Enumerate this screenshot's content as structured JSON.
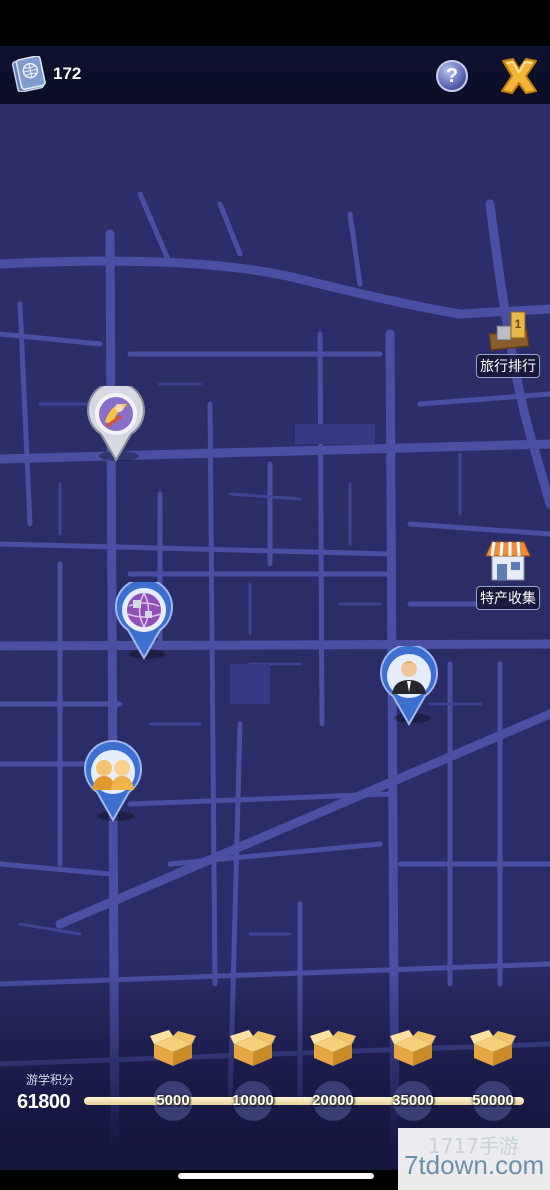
{
  "top_bar": {
    "passport_icon": "passport-icon",
    "passport_count": "172",
    "help_label": "?",
    "close_icon": "close-x-icon"
  },
  "side_buttons": {
    "ranking_label": "旅行排行",
    "specialty_label": "特产收集"
  },
  "map_pins": [
    {
      "name": "pin-opera",
      "icon": "opera-performer-icon",
      "theme": "silver"
    },
    {
      "name": "pin-globe",
      "icon": "globe-icon",
      "theme": "blue"
    },
    {
      "name": "pin-businessman",
      "icon": "businessman-icon",
      "theme": "blue"
    },
    {
      "name": "pin-family",
      "icon": "family-icon",
      "theme": "blue"
    }
  ],
  "score": {
    "label": "游学积分",
    "value": "61800"
  },
  "milestones": [
    {
      "label": "5000",
      "icon": "treasure-chest-icon"
    },
    {
      "label": "10000",
      "icon": "treasure-chest-icon"
    },
    {
      "label": "20000",
      "icon": "treasure-chest-icon"
    },
    {
      "label": "35000",
      "icon": "treasure-chest-icon"
    },
    {
      "label": "50000",
      "icon": "treasure-chest-icon"
    }
  ],
  "watermark": {
    "text": "7tdown.com",
    "logo": "1717手游"
  },
  "colors": {
    "map_background": "#2d2f6b",
    "road": "#4a4fa2",
    "progress_fill": "#f3e2b0",
    "pin_blue": "#3d6fd1",
    "pin_silver": "#bfc3cf"
  }
}
